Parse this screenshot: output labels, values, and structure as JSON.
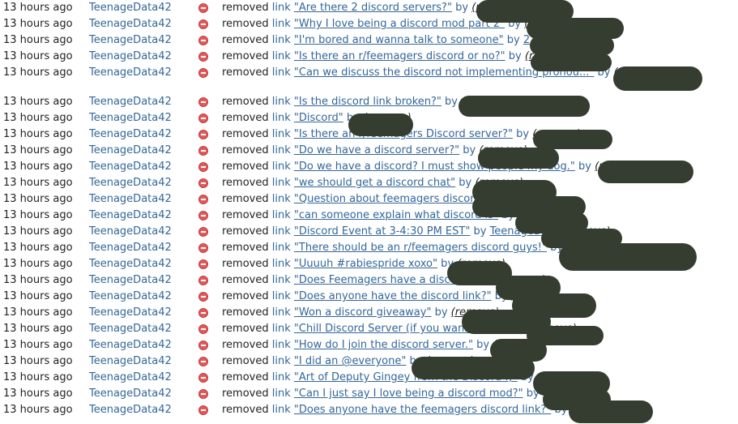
{
  "redaction_color": "#353c30",
  "entries": [
    {
      "time": "13 hours ago",
      "moderator": "TeenageData42",
      "action": "removed",
      "target_type": "link",
      "title": "\"Are there 2 discord servers?\"",
      "by": "by",
      "author": "",
      "remove": "(remove)"
    },
    {
      "time": "13 hours ago",
      "moderator": "TeenageData42",
      "action": "removed",
      "target_type": "link",
      "title": "\"Why I love being a discord mod part 2\"",
      "by": "by",
      "author": "",
      "remove": "(remove)"
    },
    {
      "time": "13 hours ago",
      "moderator": "TeenageData42",
      "action": "removed",
      "target_type": "link",
      "title": "\"I'm bored and wanna talk to someone\"",
      "by": "by",
      "author": "2",
      "remove": "(remove)"
    },
    {
      "time": "13 hours ago",
      "moderator": "TeenageData42",
      "action": "removed",
      "target_type": "link",
      "title": "\"Is there an r/feemagers discord or no?\"",
      "by": "by",
      "author": "",
      "remove": "(remove)"
    },
    {
      "time": "13 hours ago",
      "moderator": "TeenageData42",
      "action": "removed",
      "target_type": "link",
      "title": "\"Can we discuss the discord not implementing pronou...\"",
      "by": "by",
      "author": "",
      "remove": "(remove)"
    },
    {
      "time": "13 hours ago",
      "moderator": "TeenageData42",
      "action": "removed",
      "target_type": "link",
      "title": "\"Is the discord link broken?\"",
      "by": "by",
      "author": "",
      "remove": "(remove)"
    },
    {
      "time": "13 hours ago",
      "moderator": "TeenageData42",
      "action": "removed",
      "target_type": "link",
      "title": "\"Discord\"",
      "by": "by",
      "author": "",
      "remove": "(remove)"
    },
    {
      "time": "13 hours ago",
      "moderator": "TeenageData42",
      "action": "removed",
      "target_type": "link",
      "title": "\"Is there an r/feemagers Discord server?\"",
      "by": "by",
      "author": "",
      "remove": "(remove)"
    },
    {
      "time": "13 hours ago",
      "moderator": "TeenageData42",
      "action": "removed",
      "target_type": "link",
      "title": "\"Do we have a discord server?\"",
      "by": "by",
      "author": "",
      "remove": "(remove)"
    },
    {
      "time": "13 hours ago",
      "moderator": "TeenageData42",
      "action": "removed",
      "target_type": "link",
      "title": "\"Do we have a discord? I must show people my dog.\"",
      "by": "by",
      "author": "",
      "remove": "(remove)"
    },
    {
      "time": "13 hours ago",
      "moderator": "TeenageData42",
      "action": "removed",
      "target_type": "link",
      "title": "\"we should get a discord chat\"",
      "by": "by",
      "author": "",
      "remove": "(remove)"
    },
    {
      "time": "13 hours ago",
      "moderator": "TeenageData42",
      "action": "removed",
      "target_type": "link",
      "title": "\"Question about feemagers discord.\"",
      "by": "by",
      "author": "",
      "remove": "(remove)"
    },
    {
      "time": "13 hours ago",
      "moderator": "TeenageData42",
      "action": "removed",
      "target_type": "link",
      "title": "\"can someone explain what discord is\"",
      "by": "by",
      "author": "",
      "remove": "(remove)"
    },
    {
      "time": "13 hours ago",
      "moderator": "TeenageData42",
      "action": "removed",
      "target_type": "link",
      "title": "\"Discord Event at 3-4:30 PM EST\"",
      "by": "by",
      "author": "TeenageData",
      "remove": "(remove)"
    },
    {
      "time": "13 hours ago",
      "moderator": "TeenageData42",
      "action": "removed",
      "target_type": "link",
      "title": "\"There should be an r/feemagers discord guys!\"",
      "by": "by",
      "author": "",
      "remove": "(remove)"
    },
    {
      "time": "13 hours ago",
      "moderator": "TeenageData42",
      "action": "removed",
      "target_type": "link",
      "title": "\"Uuuuh #rabiespride xoxo\"",
      "by": "by",
      "author": "",
      "remove": "(remove)"
    },
    {
      "time": "13 hours ago",
      "moderator": "TeenageData42",
      "action": "removed",
      "target_type": "link",
      "title": "\"Does Feemagers have a discord?\"",
      "by": "by",
      "author": "",
      "remove": "(remove)"
    },
    {
      "time": "13 hours ago",
      "moderator": "TeenageData42",
      "action": "removed",
      "target_type": "link",
      "title": "\"Does anyone have the discord link?\"",
      "by": "by",
      "author": "",
      "remove": "(remove)"
    },
    {
      "time": "13 hours ago",
      "moderator": "TeenageData42",
      "action": "removed",
      "target_type": "link",
      "title": "\"Won a discord giveaway\"",
      "by": "by",
      "author": "",
      "remove": "(remove)"
    },
    {
      "time": "13 hours ago",
      "moderator": "TeenageData42",
      "action": "removed",
      "target_type": "link",
      "title": "\"Chill Discord Server (if you wanna join)\"",
      "by": "by",
      "author": "",
      "remove": "(remove)"
    },
    {
      "time": "13 hours ago",
      "moderator": "TeenageData42",
      "action": "removed",
      "target_type": "link",
      "title": "\"How do I join the discord server.\"",
      "by": "by",
      "author": "",
      "remove": "(remove)"
    },
    {
      "time": "13 hours ago",
      "moderator": "TeenageData42",
      "action": "removed",
      "target_type": "link",
      "title": "\"I did an @everyone\"",
      "by": "by",
      "author": "",
      "remove": "(remove)"
    },
    {
      "time": "13 hours ago",
      "moderator": "TeenageData42",
      "action": "removed",
      "target_type": "link",
      "title": "\"Art of Deputy Gingey from the Discord :)\"",
      "by": "by",
      "author": "",
      "remove": "(remove)"
    },
    {
      "time": "13 hours ago",
      "moderator": "TeenageData42",
      "action": "removed",
      "target_type": "link",
      "title": "\"Can I just say I love being a discord mod?\"",
      "by": "by",
      "author": "",
      "remove": "(remove)"
    },
    {
      "time": "13 hours ago",
      "moderator": "TeenageData42",
      "action": "removed",
      "target_type": "link",
      "title": "\"Does anyone have the feemagers discord link?\"",
      "by": "by",
      "author": "",
      "remove": "(remove)"
    }
  ]
}
